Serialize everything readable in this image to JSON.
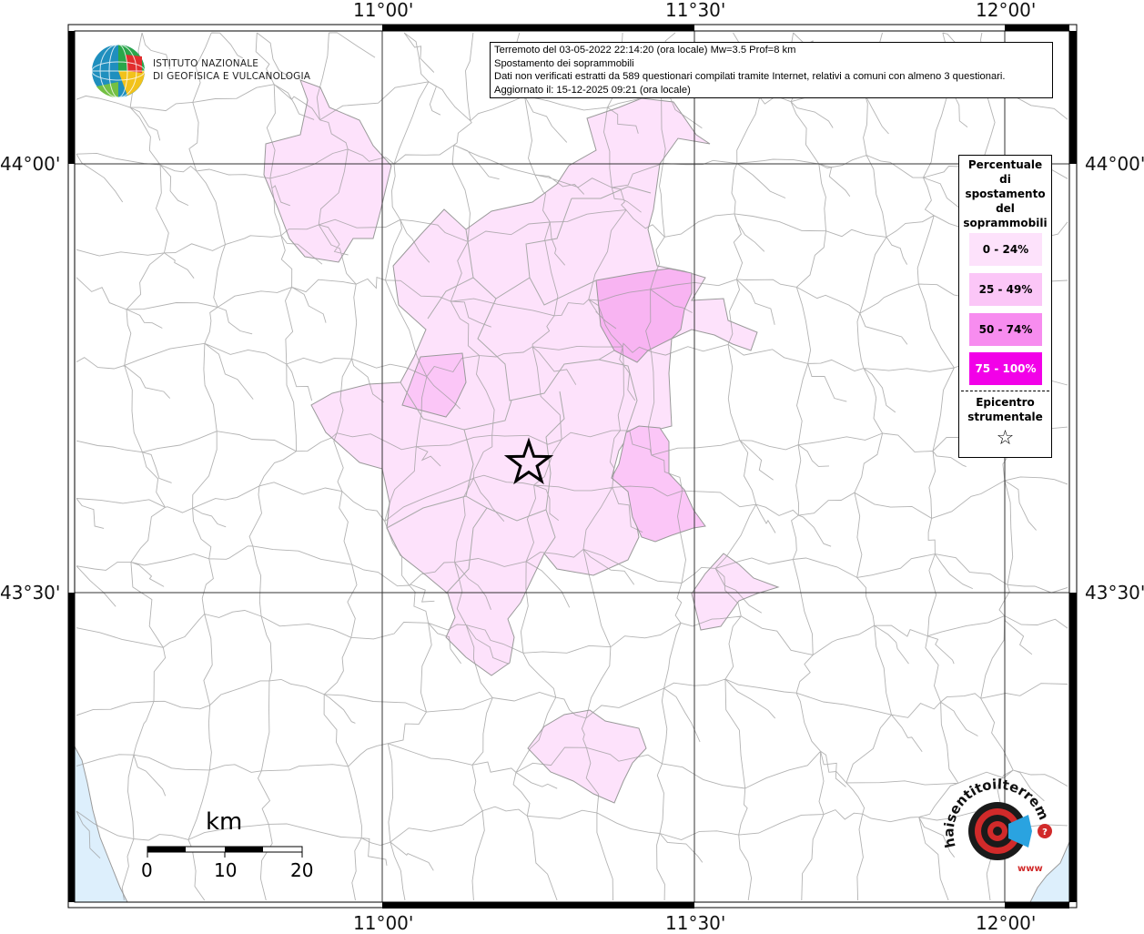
{
  "info": {
    "line1": "Terremoto del 03-05-2022 22:14:20 (ora locale) Mw=3.5 Prof=8 km",
    "line2": "Spostamento dei soprammobili",
    "line3": "Dati non verificati estratti da 589 questionari compilati tramite Internet, relativi a comuni con almeno 3 questionari.",
    "line4": "Aggiornato il: 15-12-2025 09:21 (ora locale)"
  },
  "axes": {
    "top": [
      "11°00'",
      "11°30'",
      "12°00'"
    ],
    "bottom": [
      "11°00'",
      "11°30'",
      "12°00'"
    ],
    "left": [
      "44°00'",
      "43°30'"
    ],
    "right": [
      "44°00'",
      "43°30'"
    ]
  },
  "logo": {
    "line1": "ISTITUTO NAZIONALE",
    "line2": "DI GEOFISICA E VULCANOLOGIA"
  },
  "legend": {
    "title": [
      "Percentuale",
      "di",
      "spostamento",
      "del",
      "soprammobili"
    ],
    "classes": [
      {
        "label": "0 - 24%",
        "color": "#fde2fb"
      },
      {
        "label": "25 - 49%",
        "color": "#fbc6f7"
      },
      {
        "label": "50 - 74%",
        "color": "#f78cef"
      },
      {
        "label": "75 - 100%",
        "color": "#f200e8"
      }
    ],
    "epicenter": [
      "Epicentro",
      "strumentale"
    ],
    "star": "☆"
  },
  "scale": {
    "unit": "km",
    "ticks": [
      "0",
      "10",
      "20"
    ]
  },
  "colors": {
    "sea": "#ddeffc",
    "boundary": "#9a9a9a",
    "grid": "#333333"
  },
  "watermark": {
    "text": "haisentitoilterremoto.it",
    "url": "www"
  }
}
